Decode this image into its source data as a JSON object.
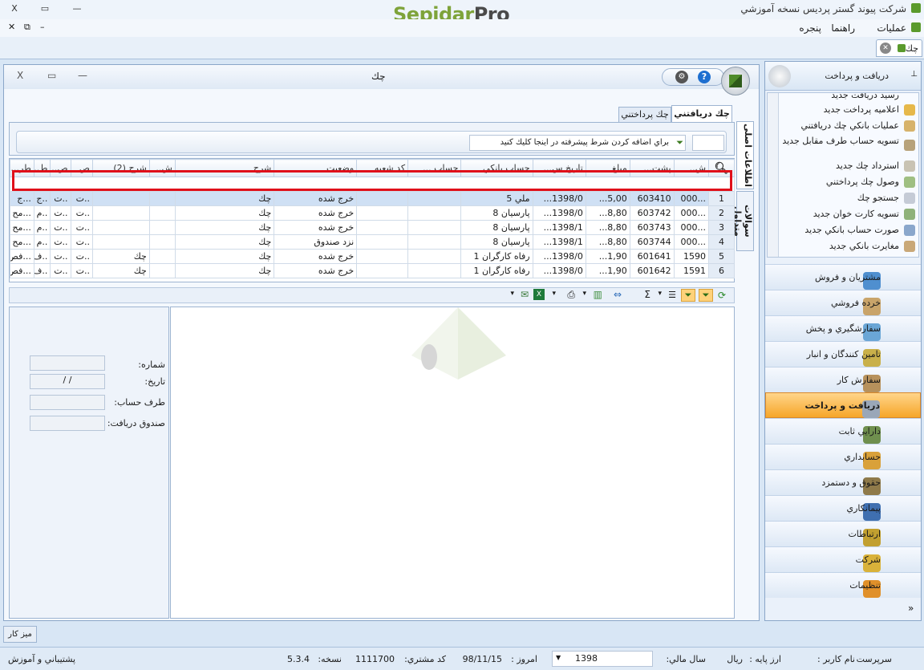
{
  "app": {
    "company_title": "شرکت پیوند گستر پردیس نسخه آموزشي",
    "logo": "SepidarPro"
  },
  "menu": {
    "items": [
      "عملیات",
      "راهنما",
      "پنجره"
    ]
  },
  "doc_tab": {
    "label": "چك"
  },
  "child_window": {
    "title": "چك",
    "tab_received": "چك دريافتني",
    "tab_payable": "چك پرداختني",
    "side_tab_1": "اطلاعات اصلی",
    "side_tab_2": "سوالات متداول",
    "filter_hint": "براي اضافه کردن شرط پيشرفته در اينجا کليك کنيد"
  },
  "grid": {
    "headers": [
      "ش..",
      "پشت...",
      "مبلغ",
      "تاريخ س...",
      "حساب بانکي",
      "حساب ...",
      "کد شعبه",
      "وضعيت",
      "شرح",
      "ش..",
      "شرح (2)",
      "ص",
      "ص..",
      "ط..",
      "طر..."
    ],
    "rows": [
      [
        "1",
        "...000",
        "603410",
        "5,00...",
        "1398/0...",
        "ملي  5",
        "",
        "",
        "خرج شده",
        "چك",
        "",
        "",
        "..ت",
        "..ت",
        "..ج",
        "...ج"
      ],
      [
        "2",
        "...000",
        "603742",
        "8,80...",
        "1398/0...",
        "پارسيان  8",
        "",
        "",
        "خرج شده",
        "چك",
        "",
        "",
        "..ت",
        "..ت",
        "..م",
        "...مح"
      ],
      [
        "3",
        "...000",
        "603743",
        "8,80...",
        "1398/1...",
        "پارسيان  8",
        "",
        "",
        "خرج شده",
        "چك",
        "",
        "",
        "..ت",
        "..ت",
        "..م",
        "...مح"
      ],
      [
        "4",
        "...000",
        "603744",
        "8,80...",
        "1398/1...",
        "پارسيان  8",
        "",
        "",
        "نزد صندوق",
        "چك",
        "",
        "",
        "..ت",
        "..ت",
        "..م",
        "...مح"
      ],
      [
        "5",
        "1590",
        "601641",
        "1,90...",
        "1398/0...",
        "رفاه کارگران  1",
        "",
        "",
        "خرج شده",
        "چك",
        "",
        "چك",
        "..ت",
        "..ت",
        "..ف",
        "...فص"
      ],
      [
        "6",
        "1591",
        "601642",
        "1,90...",
        "1398/0...",
        "رفاه کارگران  1",
        "",
        "",
        "خرج شده",
        "چك",
        "",
        "چك",
        "..ت",
        "..ت",
        "..ف",
        "...فص"
      ]
    ]
  },
  "detail_form": {
    "number_label": "شماره:",
    "date_label": "تاريخ:",
    "date_value": "/ /",
    "party_label": "طرف حساب:",
    "cashbox_label": "صندوق دريافت:"
  },
  "nav": {
    "header": "دريافت و پرداخت",
    "items": [
      "رسيد دريافت جديد",
      "اعلاميه پرداخت جديد",
      "عمليات بانکي چك دريافتني",
      "تسويه حساب طرف مقابل جديد",
      "استرداد چك جديد",
      "وصول چك پرداختني",
      "جستجو چك",
      "تسويه کارت خوان جديد",
      "صورت حساب بانکي جديد",
      "مغايرت بانکي جديد"
    ],
    "groups": [
      "مشتريان و فروش",
      "خرده فروشي",
      "سفارشگيري و پخش",
      "تامين کنندگان و انبار",
      "سفارش كار",
      "دريافت و پرداخت",
      "دارايي ثابت",
      "حسابداري",
      "حقوق و دستمزد",
      "پيمانکاري",
      "ارتباطات",
      "شرکت",
      "تنظيمات"
    ],
    "active_group": "دريافت و پرداخت"
  },
  "desk_button": "ميز کار",
  "status": {
    "user_label": "نام کاربر :",
    "user_value": "سرپرست",
    "currency_label": "ارز پايه :",
    "currency_value": "ريال",
    "fiscal_label": "سال مالي:",
    "fiscal_value": "1398",
    "today_label": "امروز :",
    "today_value": "98/11/15",
    "customer_label": "کد مشتري:",
    "customer_value": "1111700",
    "version_label": "نسخه:",
    "version_value": "5.3.4",
    "support": "پشتيباني و آموزش"
  },
  "colors": {
    "logo_green": "#7ea33a",
    "logo_dark": "#4a4a4a",
    "highlight_red": "#e0101a",
    "active_orange": "#f6a629"
  }
}
